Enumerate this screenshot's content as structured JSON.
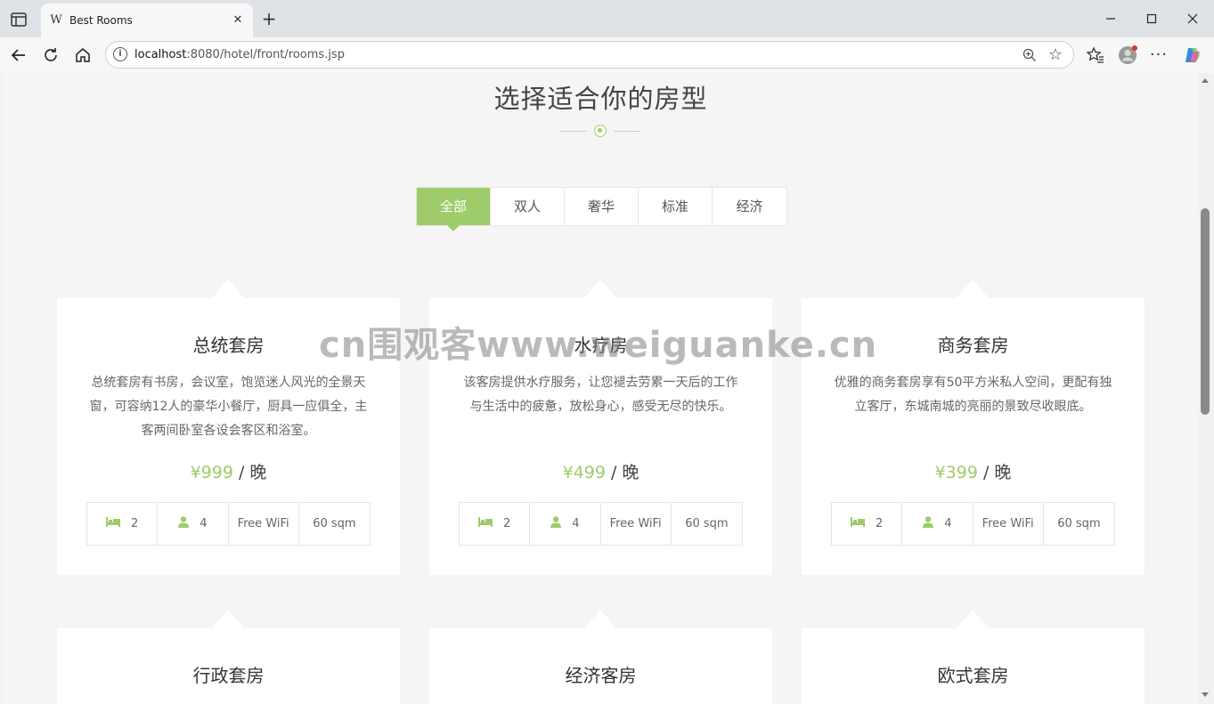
{
  "browser": {
    "tab_title": "Best Rooms",
    "tab_favicon": "W",
    "url_host": "localhost",
    "url_rest": ":8080/hotel/front/rooms.jsp"
  },
  "page": {
    "title": "选择适合你的房型",
    "accent_color": "#9fcc6a"
  },
  "filters": [
    "全部",
    "双人",
    "奢华",
    "标准",
    "经济"
  ],
  "rooms": [
    {
      "name": "总统套房",
      "desc": "总统套房有书房，会议室，饱览迷人风光的全景天窗，可容纳12人的豪华小餐厅，厨具一应俱全，主客两间卧室各设会客区和浴室。",
      "price": "¥999",
      "per": " / 晚",
      "beds": "2",
      "guests": "4",
      "wifi": "Free WiFi",
      "area": "60 sqm"
    },
    {
      "name": "水疗房",
      "desc": "该客房提供水疗服务，让您褪去劳累一天后的工作与生活中的疲惫，放松身心，感受无尽的快乐。",
      "price": "¥499",
      "per": " / 晚",
      "beds": "2",
      "guests": "4",
      "wifi": "Free WiFi",
      "area": "60 sqm"
    },
    {
      "name": "商务套房",
      "desc": "优雅的商务套房享有50平方米私人空间，更配有独立客厅，东城南城的亮丽的景致尽收眼底。",
      "price": "¥399",
      "per": " / 晚",
      "beds": "2",
      "guests": "4",
      "wifi": "Free WiFi",
      "area": "60 sqm"
    },
    {
      "name": "行政套房"
    },
    {
      "name": "经济客房"
    },
    {
      "name": "欧式套房"
    }
  ],
  "watermark": "cn围观客www.weiguanke.cn"
}
